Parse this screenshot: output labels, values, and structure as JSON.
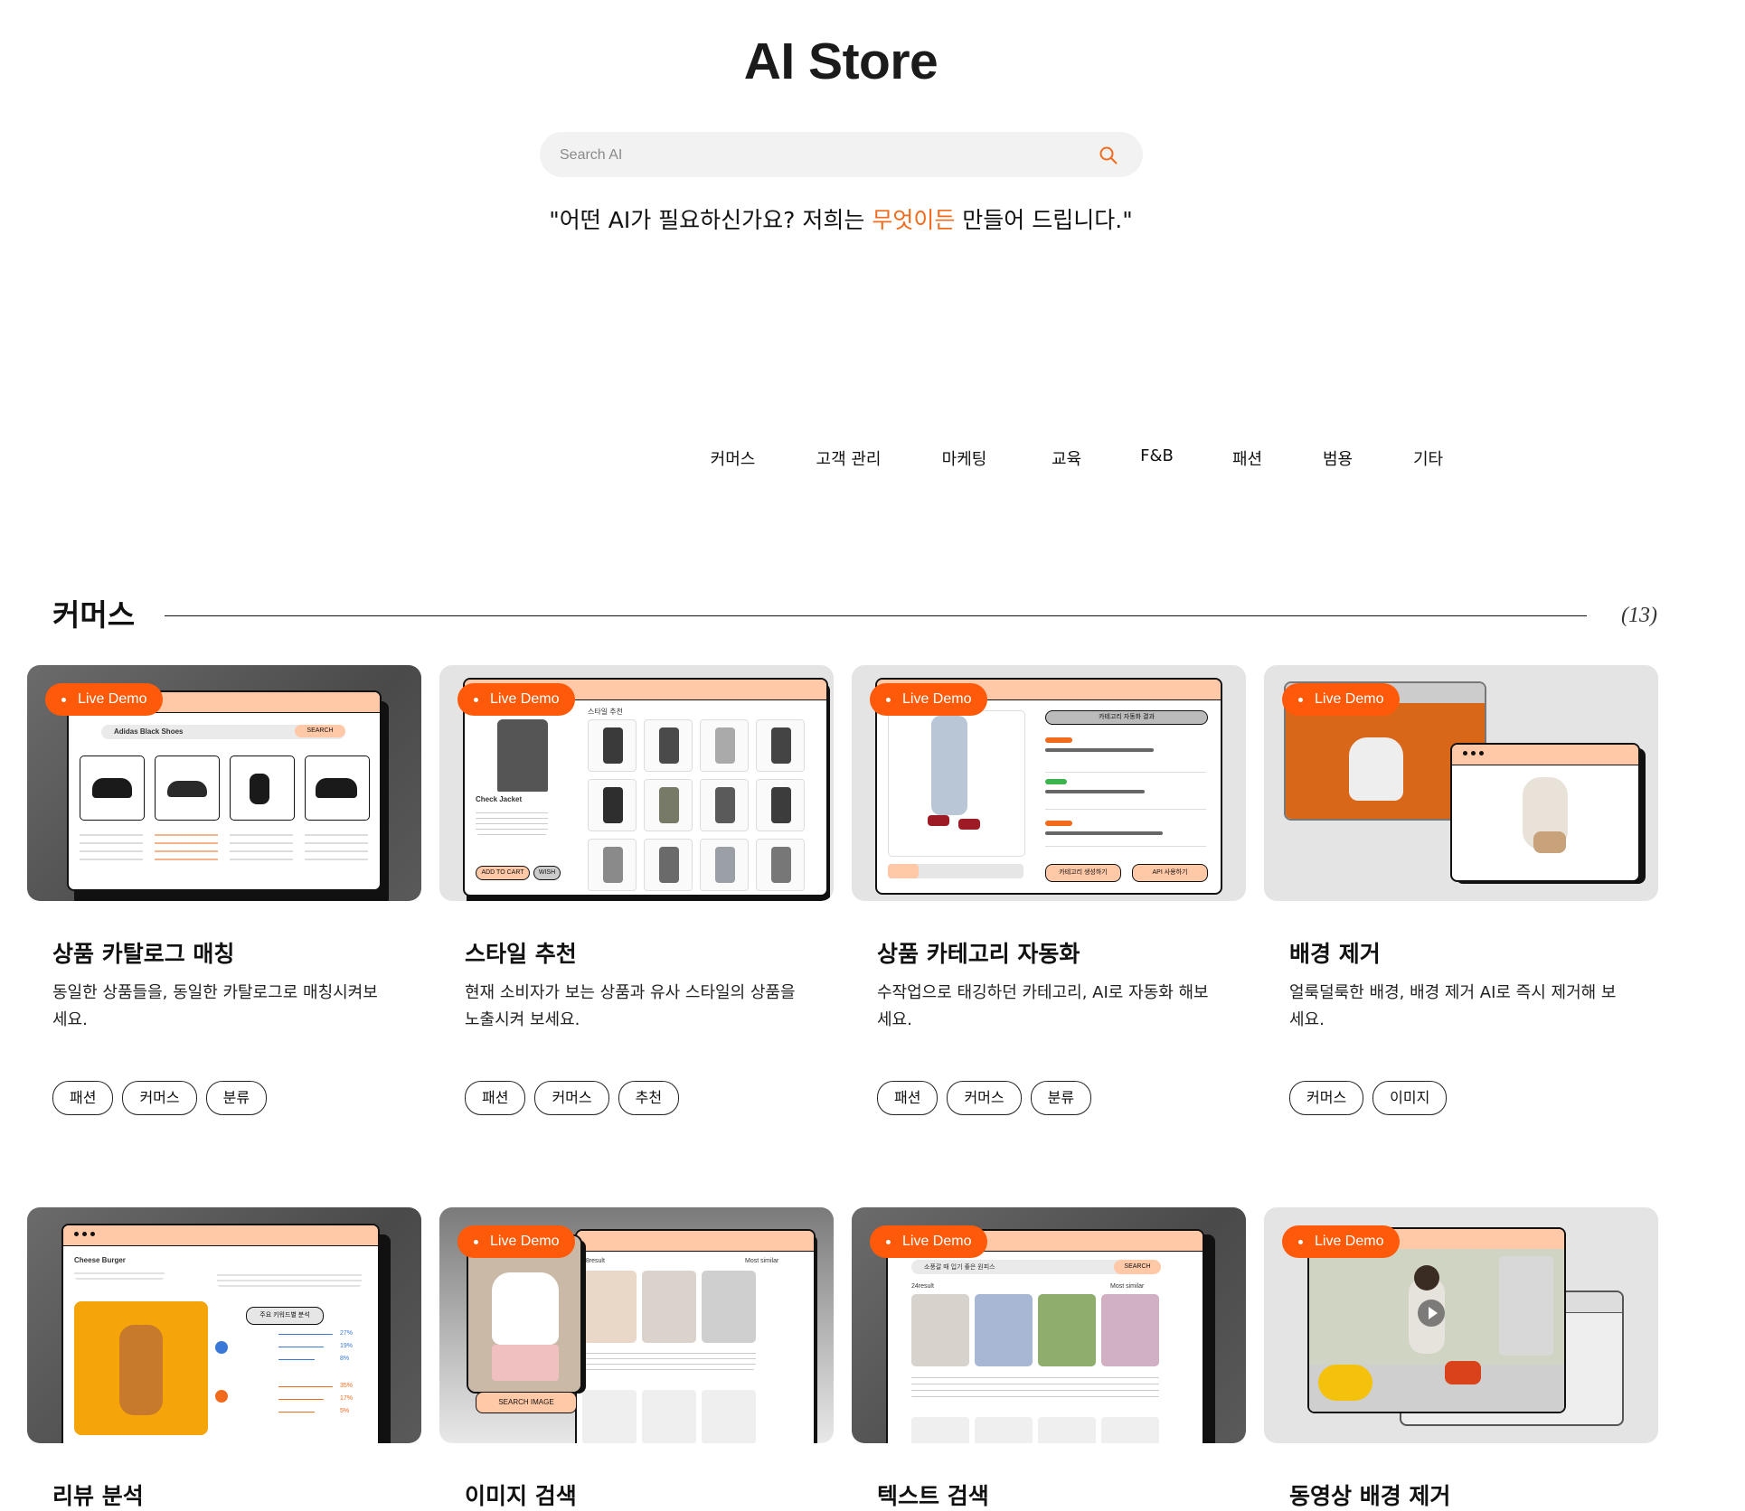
{
  "header": {
    "title": "AI Store",
    "search_placeholder": "Search AI",
    "tagline_before": "\"어떤 AI가 필요하신가요? 저희는 ",
    "tagline_accent": "무엇이든",
    "tagline_after": " 만들어 드립니다.\""
  },
  "tabs": [
    "커머스",
    "고객 관리",
    "마케팅",
    "교육",
    "F&B",
    "패션",
    "범용",
    "기타"
  ],
  "section": {
    "title": "커머스",
    "count": "(13)"
  },
  "live_badge": "Live Demo",
  "cards": [
    {
      "title": "상품 카탈로그 매칭",
      "desc": "동일한 상품들을, 동일한 카탈로그로 매칭시켜보세요.",
      "tags": [
        "패션",
        "커머스",
        "분류"
      ],
      "mock_search": "Adidas Black Shoes",
      "mock_button": "SEARCH"
    },
    {
      "title": "스타일 추천",
      "desc": "현재 소비자가 보는 상품과 유사 스타일의 상품을 노출시켜 보세요.",
      "tags": [
        "패션",
        "커머스",
        "추천"
      ],
      "mock_heading": "스타일 추천",
      "mock_product": "Check Jacket",
      "mock_add": "ADD TO CART",
      "mock_wish": "WISH"
    },
    {
      "title": "상품 카테고리 자동화",
      "desc": "수작업으로 태깅하던 카테고리, AI로 자동화 해보세요.",
      "tags": [
        "패션",
        "커머스",
        "분류"
      ],
      "mock_heading": "카테고리 자동화 결과",
      "mock_btn1": "카테고리 생성하기",
      "mock_btn2": "API 사용하기"
    },
    {
      "title": "배경 제거",
      "desc": "얼룩덜룩한 배경, 배경 제거 AI로 즉시 제거해 보세요.",
      "tags": [
        "커머스",
        "이미지"
      ]
    },
    {
      "title": "리뷰 분석",
      "mock_product": "Cheese Burger",
      "mock_button": "주요 키워드별 분석",
      "mock_pos": [
        "27%",
        "19%",
        "8%"
      ],
      "mock_neg": [
        "35%",
        "17%",
        "5%"
      ]
    },
    {
      "title": "이미지 검색",
      "mock_result": "28result",
      "mock_sort": "Most similar",
      "mock_button": "SEARCH IMAGE"
    },
    {
      "title": "텍스트 검색",
      "mock_search": "소풍갈 때 입기 좋은 원피스",
      "mock_button": "SEARCH",
      "mock_result": "24result",
      "mock_sort": "Most similar"
    },
    {
      "title": "동영상 배경 제거"
    }
  ],
  "colors": {
    "accent": "#f26b1d",
    "badge": "#ff5a0a",
    "peach": "#ffc8a7"
  }
}
